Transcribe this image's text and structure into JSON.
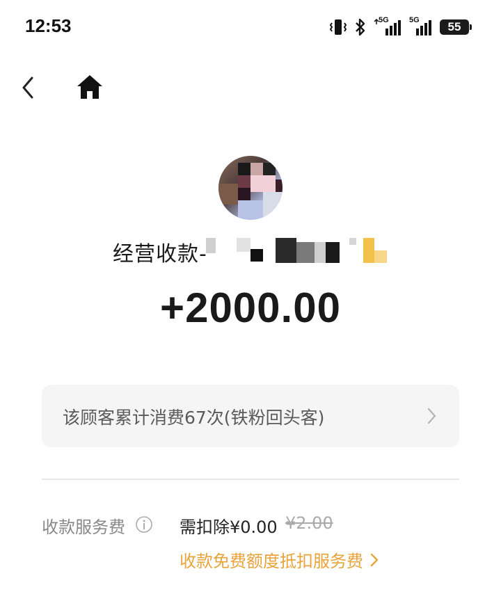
{
  "status_bar": {
    "time": "12:53",
    "network_1": "5G",
    "network_2": "5G",
    "battery": "55"
  },
  "nav": {
    "back_icon": "chevron-left-icon",
    "home_icon": "home-icon"
  },
  "transaction": {
    "payer_prefix": "经营收款-",
    "amount": "+2000.00"
  },
  "customer_card": {
    "text": "该顾客累计消费67次(铁粉回头客)"
  },
  "fee": {
    "label": "收款服务费",
    "deduct_value": "需扣除¥0.00",
    "original_value": "¥2.00",
    "promo_link": "收款免费额度抵扣服务费"
  },
  "colors": {
    "accent_orange": "#e8a33a",
    "card_bg": "#f5f5f5",
    "text_primary": "#1a1a1a",
    "text_secondary": "#888888"
  }
}
